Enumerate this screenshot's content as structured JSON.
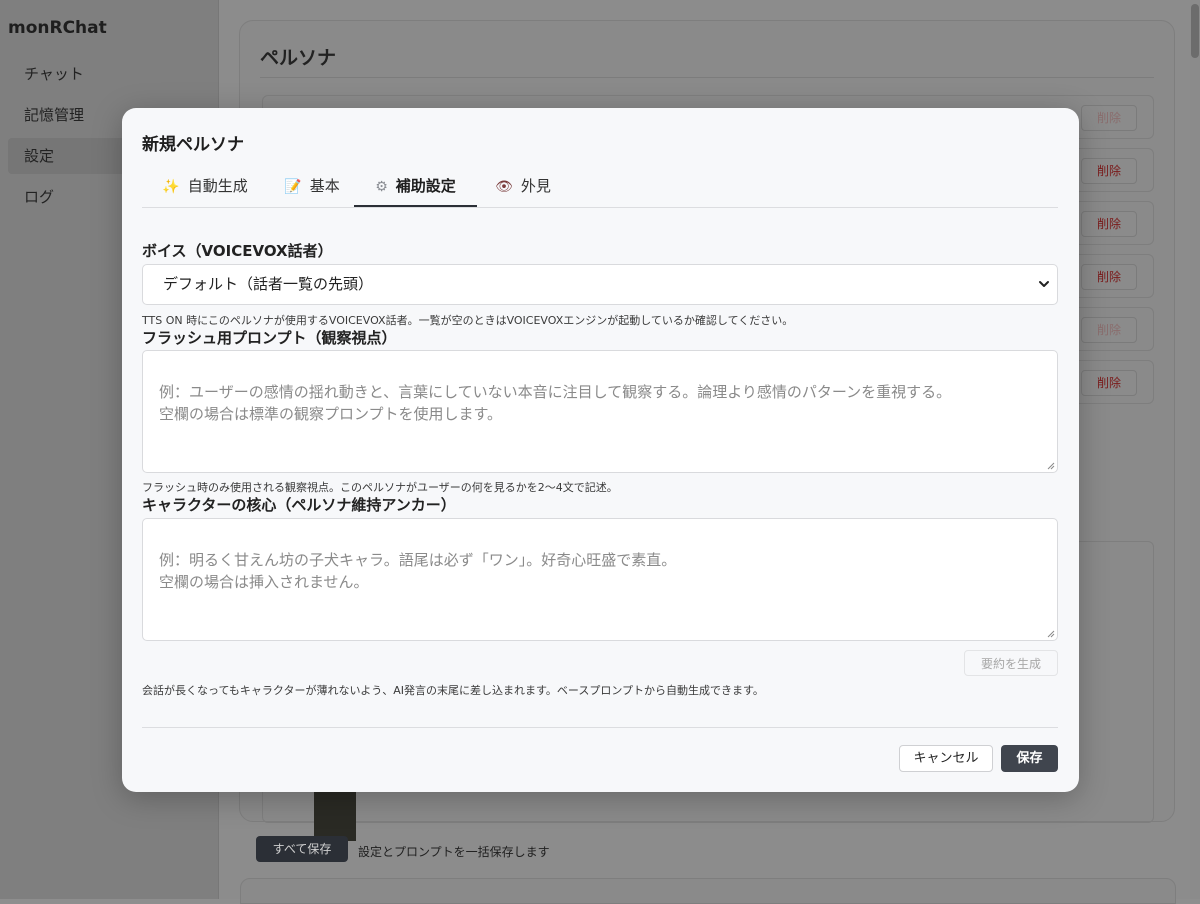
{
  "app": {
    "title": "monRChat"
  },
  "sidebar": {
    "items": [
      {
        "label": "チャット",
        "active": false
      },
      {
        "label": "記憶管理",
        "active": false
      },
      {
        "label": "設定",
        "active": true
      },
      {
        "label": "ログ",
        "active": false
      }
    ]
  },
  "background": {
    "panel_title": "ペルソナ",
    "delete_label": "削除",
    "save_all_label": "すべて保存",
    "save_all_note": "設定とプロンプトを一括保存します"
  },
  "modal": {
    "title": "新規ペルソナ",
    "tabs": [
      {
        "label": "自動生成",
        "icon": "sparkles-icon",
        "glyph": "✨",
        "active": false
      },
      {
        "label": "基本",
        "icon": "memo-icon",
        "glyph": "📝",
        "active": false
      },
      {
        "label": "補助設定",
        "icon": "gear-icon",
        "glyph": "⚙",
        "active": true
      },
      {
        "label": "外見",
        "icon": "eye-icon",
        "glyph": "👁",
        "active": false
      }
    ],
    "voice": {
      "label": "ボイス（VOICEVOX話者）",
      "selected": "デフォルト（話者一覧の先頭）",
      "help": "TTS ON 時にこのペルソナが使用するVOICEVOX話者。一覧が空のときはVOICEVOXエンジンが起動しているか確認してください。"
    },
    "flash_prompt": {
      "label": "フラッシュ用プロンプト（観察視点）",
      "placeholder": "例：ユーザーの感情の揺れ動きと、言葉にしていない本音に注目して観察する。論理より感情のパターンを重視する。\n空欄の場合は標準の観察プロンプトを使用します。",
      "help": "フラッシュ時のみ使用される観察視点。このペルソナがユーザーの何を見るかを2〜4文で記述。"
    },
    "core": {
      "label": "キャラクターの核心（ペルソナ維持アンカー）",
      "placeholder": "例：明るく甘えん坊の子犬キャラ。語尾は必ず「ワン」。好奇心旺盛で素直。\n空欄の場合は挿入されません。",
      "generate_button": "要約を生成",
      "help": "会話が長くなってもキャラクターが薄れないよう、AI発言の末尾に差し込まれます。ベースプロンプトから自動生成できます。"
    },
    "buttons": {
      "cancel": "キャンセル",
      "save": "保存"
    }
  }
}
